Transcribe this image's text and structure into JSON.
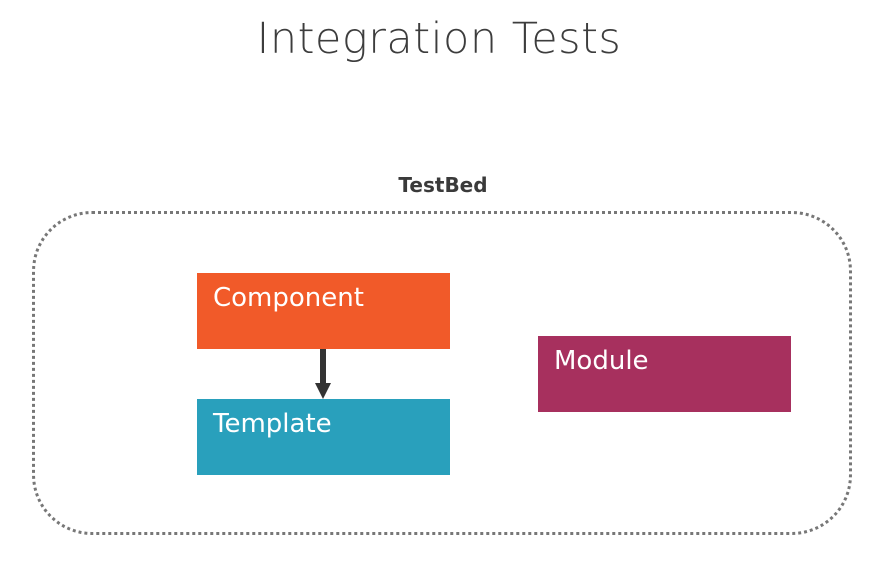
{
  "title": "Integration Tests",
  "container": {
    "label": "TestBed"
  },
  "nodes": {
    "component": "Component",
    "template": "Template",
    "module": "Module"
  },
  "colors": {
    "component": "#f15a29",
    "template": "#29a0bc",
    "module": "#a7305e",
    "arrow": "#333333",
    "border": "#777777"
  }
}
